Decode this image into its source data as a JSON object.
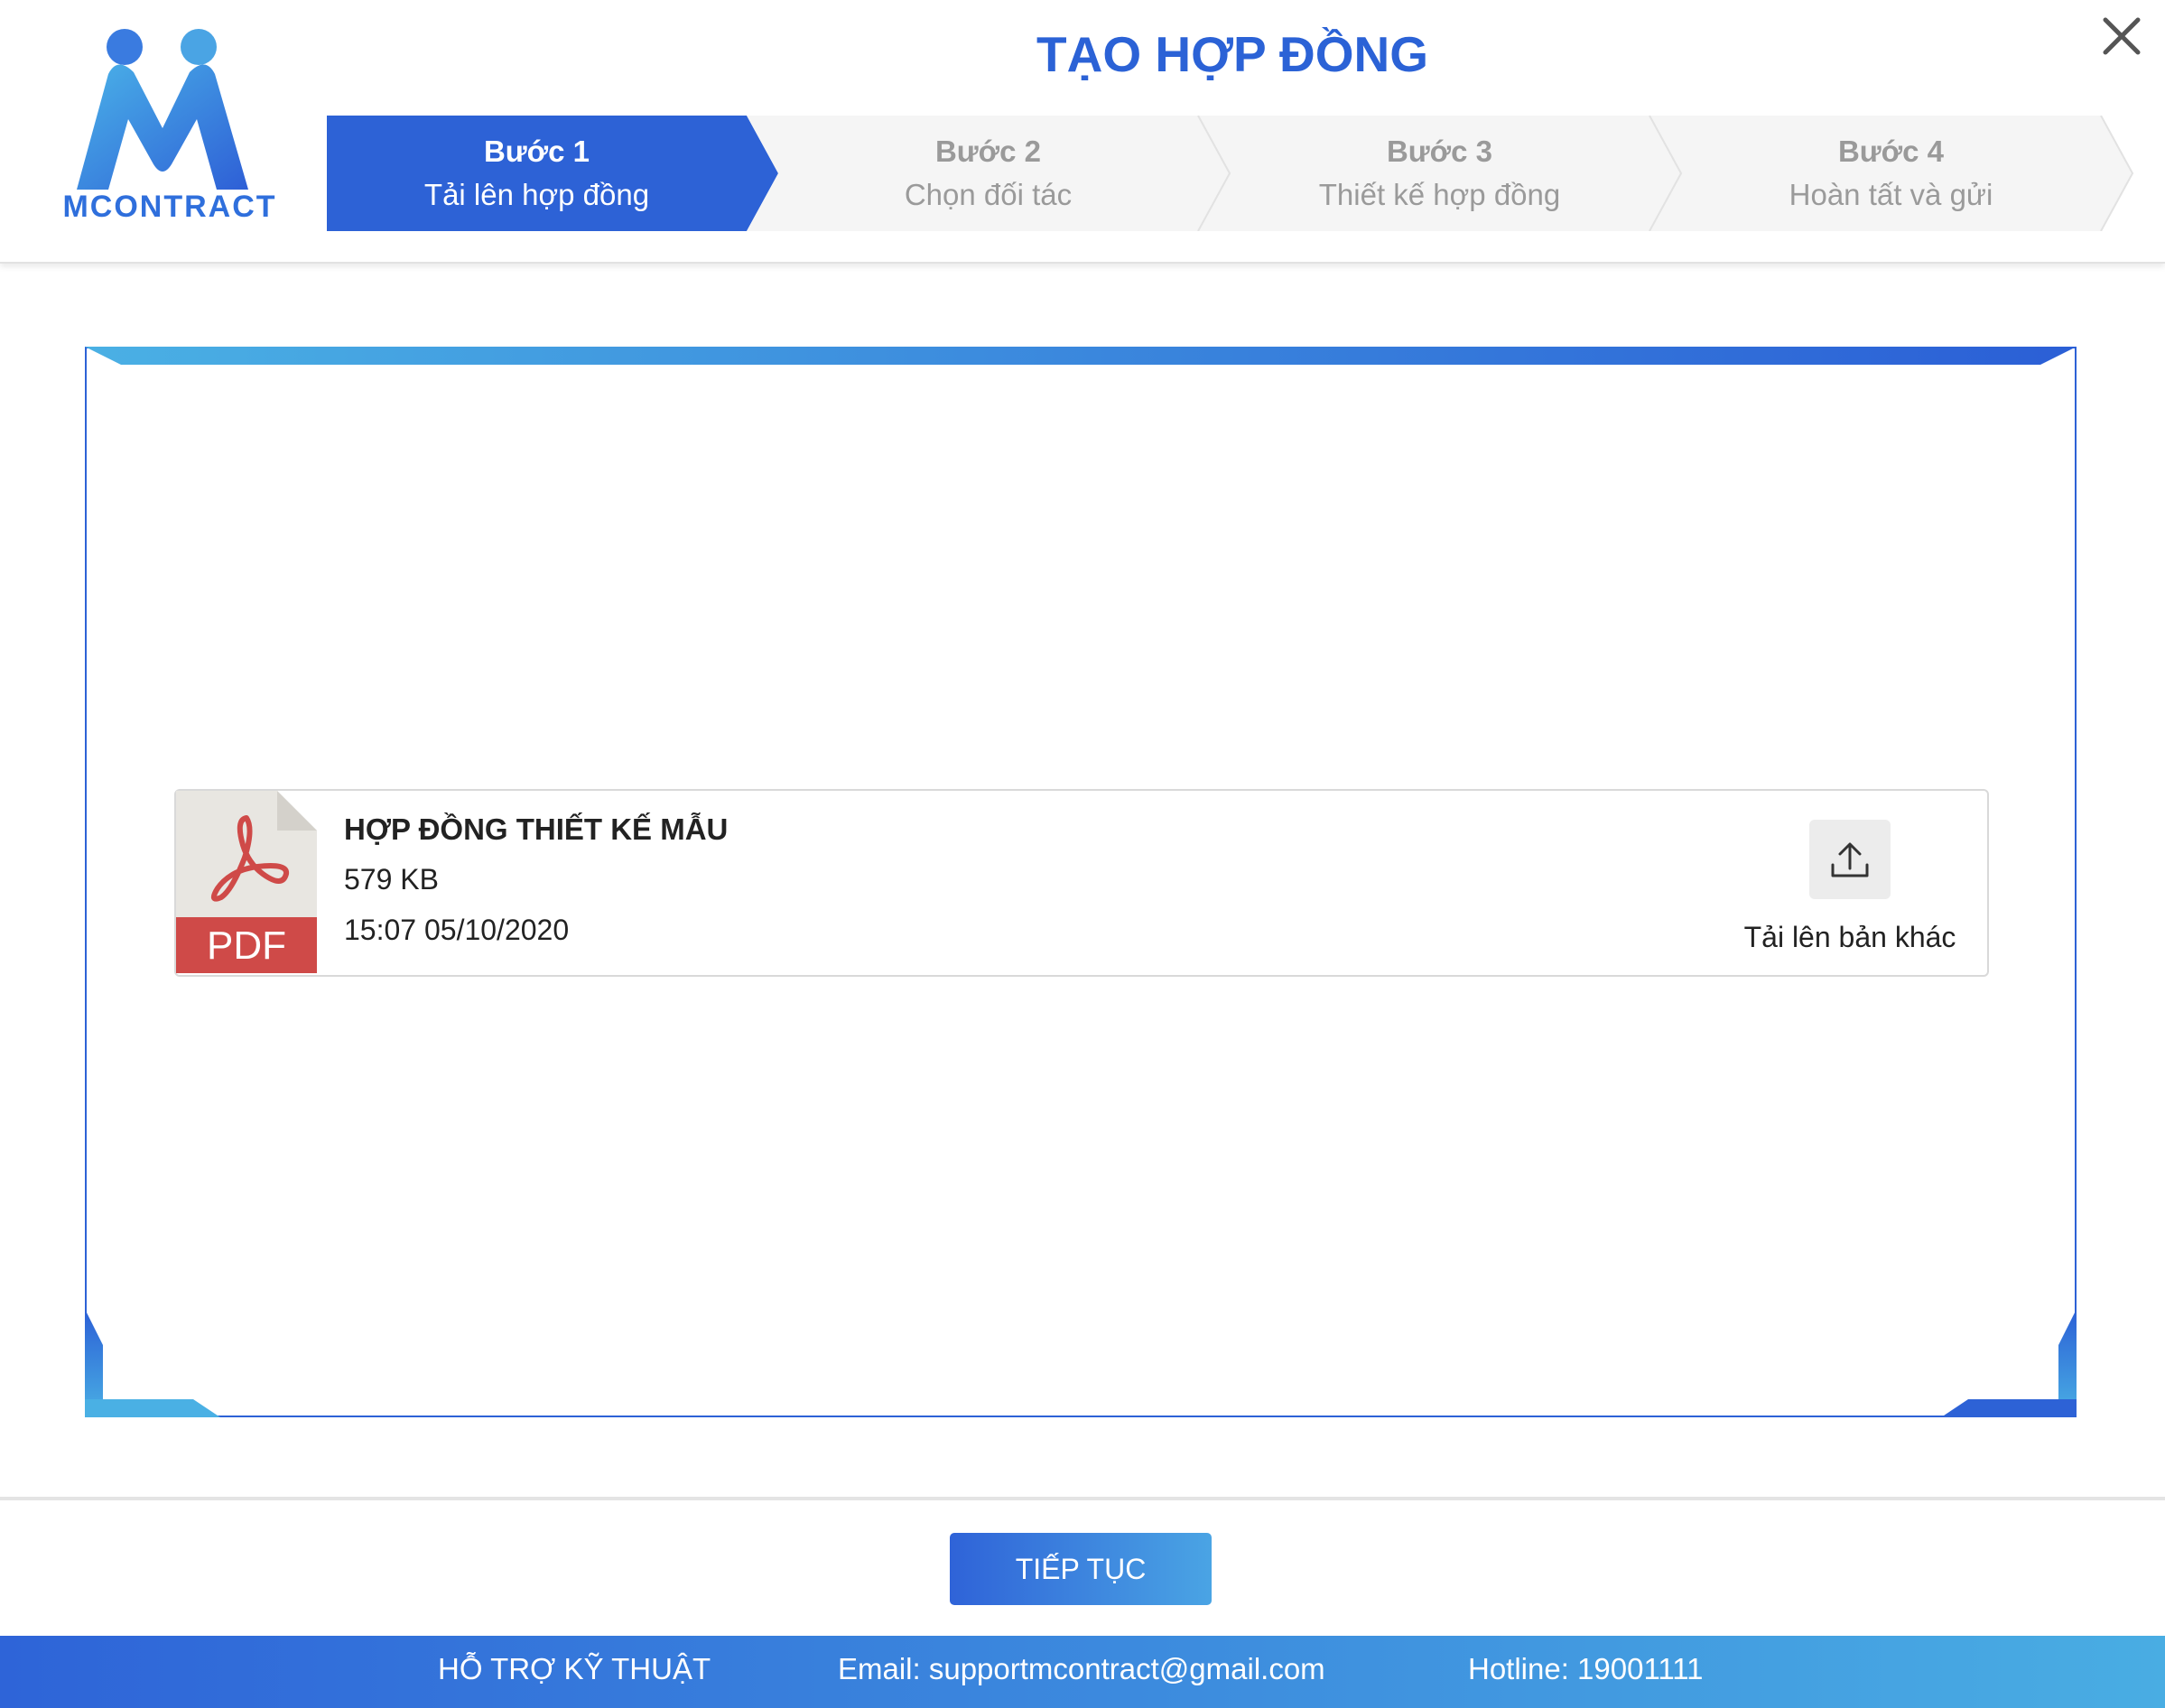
{
  "app": {
    "logo_text": "MCONTRACT",
    "title": "TẠO HỢP ĐỒNG"
  },
  "steps": [
    {
      "number": "Bước 1",
      "label": "Tải lên hợp đồng",
      "active": true
    },
    {
      "number": "Bước 2",
      "label": "Chọn đối tác",
      "active": false
    },
    {
      "number": "Bước 3",
      "label": "Thiết kế hợp đồng",
      "active": false
    },
    {
      "number": "Bước 4",
      "label": "Hoàn tất và gửi",
      "active": false
    }
  ],
  "file": {
    "name": "HỢP ĐỒNG THIẾT KẾ MẪU",
    "size": "579 KB",
    "date": "15:07 05/10/2020",
    "type_label": "PDF",
    "upload_label": "Tải lên bản khác"
  },
  "actions": {
    "continue_label": "TIẾP TỤC"
  },
  "support": {
    "heading": "HỖ TRỢ KỸ THUẬT",
    "email": "Email: supportmcontract@gmail.com",
    "hotline": "Hotline: 19001111"
  },
  "colors": {
    "primary": "#2b62d6",
    "accent": "#4aa4e4",
    "step_idle_bg": "#f5f5f5",
    "pdf_red": "#cf4a48"
  }
}
